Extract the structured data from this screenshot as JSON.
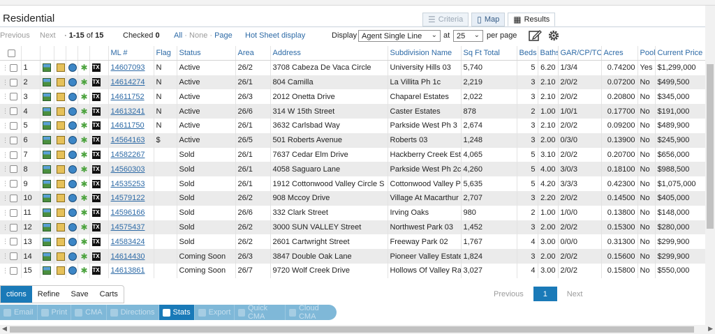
{
  "header": {
    "title": "Residential",
    "tabs": {
      "criteria": "Criteria",
      "map": "Map",
      "results": "Results"
    }
  },
  "toolbar": {
    "previous": "Previous",
    "next": "Next",
    "range": "1-15",
    "of_label": "of",
    "total": "15",
    "checked_label": "Checked",
    "checked_count": "0",
    "select_all": "All",
    "select_none": "None",
    "select_page": "Page",
    "hot_sheet": "Hot Sheet display",
    "display_label": "Display",
    "display_value": "Agent Single Line",
    "at_label": "at",
    "per_page_value": "25",
    "per_page_label": "per page"
  },
  "table": {
    "columns": [
      "ML #",
      "Flag",
      "Status",
      "Area",
      "Address",
      "Subdivision Name",
      "Sq Ft Total",
      "Beds",
      "Baths",
      "GAR/CP/TCP",
      "Acres",
      "Pool",
      "Current Price"
    ],
    "rows": [
      {
        "n": "1",
        "ml": "14607093",
        "flag": "N",
        "status": "Active",
        "area": "26/2",
        "address": "3708 Cabeza De Vaca Circle",
        "subdivision": "University Hills 03",
        "sqft": "5,740",
        "beds": "5",
        "baths": "6.20",
        "gar": "1/3/4",
        "acres": "0.74200",
        "pool": "Yes",
        "price": "$1,299,000"
      },
      {
        "n": "2",
        "ml": "14614274",
        "flag": "N",
        "status": "Active",
        "area": "26/1",
        "address": "804 Camilla",
        "subdivision": "La Villita Ph 1c",
        "sqft": "2,219",
        "beds": "3",
        "baths": "2.10",
        "gar": "2/0/2",
        "acres": "0.07200",
        "pool": "No",
        "price": "$499,500"
      },
      {
        "n": "3",
        "ml": "14611752",
        "flag": "N",
        "status": "Active",
        "area": "26/3",
        "address": "2012 Onetta Drive",
        "subdivision": "Chaparel Estates",
        "sqft": "2,022",
        "beds": "3",
        "baths": "2.10",
        "gar": "2/0/2",
        "acres": "0.20800",
        "pool": "No",
        "price": "$345,000"
      },
      {
        "n": "4",
        "ml": "14613241",
        "flag": "N",
        "status": "Active",
        "area": "26/6",
        "address": "314 W 15th Street",
        "subdivision": "Caster Estates",
        "sqft": "878",
        "beds": "2",
        "baths": "1.00",
        "gar": "1/0/1",
        "acres": "0.17700",
        "pool": "No",
        "price": "$191,000"
      },
      {
        "n": "5",
        "ml": "14611750",
        "flag": "N",
        "status": "Active",
        "area": "26/1",
        "address": "3632 Carlsbad Way",
        "subdivision": "Parkside West Ph 3",
        "sqft": "2,674",
        "beds": "3",
        "baths": "2.10",
        "gar": "2/0/2",
        "acres": "0.09200",
        "pool": "No",
        "price": "$489,900"
      },
      {
        "n": "6",
        "ml": "14564163",
        "flag": "$",
        "status": "Active",
        "area": "26/5",
        "address": "501 Roberts Avenue",
        "subdivision": "Roberts 03",
        "sqft": "1,248",
        "beds": "3",
        "baths": "2.00",
        "gar": "0/3/0",
        "acres": "0.13900",
        "pool": "No",
        "price": "$245,900"
      },
      {
        "n": "7",
        "ml": "14582267",
        "flag": "",
        "status": "Sold",
        "area": "26/1",
        "address": "7637 Cedar Elm Drive",
        "subdivision": "Hackberry Creek Esta",
        "sqft": "4,065",
        "beds": "5",
        "baths": "3.10",
        "gar": "2/0/2",
        "acres": "0.20700",
        "pool": "No",
        "price": "$656,000"
      },
      {
        "n": "8",
        "ml": "14560303",
        "flag": "",
        "status": "Sold",
        "area": "26/1",
        "address": "4058 Saguaro Lane",
        "subdivision": "Parkside West Ph 2c",
        "sqft": "4,260",
        "beds": "5",
        "baths": "4.00",
        "gar": "3/0/3",
        "acres": "0.18100",
        "pool": "No",
        "price": "$988,500"
      },
      {
        "n": "9",
        "ml": "14535253",
        "flag": "",
        "status": "Sold",
        "area": "26/1",
        "address": "1912 Cottonwood Valley Circle S",
        "subdivision": "Cottonwood Valley Ph",
        "sqft": "5,635",
        "beds": "5",
        "baths": "4.20",
        "gar": "3/3/3",
        "acres": "0.42300",
        "pool": "No",
        "price": "$1,075,000"
      },
      {
        "n": "10",
        "ml": "14579122",
        "flag": "",
        "status": "Sold",
        "area": "26/2",
        "address": "908 Mccoy Drive",
        "subdivision": "Village At Macarthur C",
        "sqft": "2,707",
        "beds": "3",
        "baths": "2.20",
        "gar": "2/0/2",
        "acres": "0.14500",
        "pool": "No",
        "price": "$405,000"
      },
      {
        "n": "11",
        "ml": "14596166",
        "flag": "",
        "status": "Sold",
        "area": "26/6",
        "address": "332 Clark Street",
        "subdivision": "Irving Oaks",
        "sqft": "980",
        "beds": "2",
        "baths": "1.00",
        "gar": "1/0/0",
        "acres": "0.13800",
        "pool": "No",
        "price": "$148,000"
      },
      {
        "n": "12",
        "ml": "14575437",
        "flag": "",
        "status": "Sold",
        "area": "26/2",
        "address": "3000 SUN VALLEY Street",
        "subdivision": "Northwest Park 03",
        "sqft": "1,452",
        "beds": "3",
        "baths": "2.00",
        "gar": "2/0/2",
        "acres": "0.15300",
        "pool": "No",
        "price": "$280,000"
      },
      {
        "n": "13",
        "ml": "14583424",
        "flag": "",
        "status": "Sold",
        "area": "26/2",
        "address": "2601 Cartwright Street",
        "subdivision": "Freeway Park 02",
        "sqft": "1,767",
        "beds": "4",
        "baths": "3.00",
        "gar": "0/0/0",
        "acres": "0.31300",
        "pool": "No",
        "price": "$299,900"
      },
      {
        "n": "14",
        "ml": "14614430",
        "flag": "",
        "status": "Coming Soon",
        "area": "26/3",
        "address": "3847 Double Oak Lane",
        "subdivision": "Pioneer Valley Estate",
        "sqft": "1,824",
        "beds": "3",
        "baths": "2.00",
        "gar": "2/0/2",
        "acres": "0.15600",
        "pool": "No",
        "price": "$299,900"
      },
      {
        "n": "15",
        "ml": "14613861",
        "flag": "",
        "status": "Coming Soon",
        "area": "26/7",
        "address": "9720 Wolf Creek Drive",
        "subdivision": "Hollows Of Valley Ran",
        "sqft": "3,027",
        "beds": "4",
        "baths": "3.00",
        "gar": "2/0/2",
        "acres": "0.15800",
        "pool": "No",
        "price": "$550,000"
      }
    ]
  },
  "bottom_tabs": [
    "ctions",
    "Refine",
    "Save",
    "Carts"
  ],
  "actions": [
    "Email",
    "Print",
    "CMA",
    "Directions",
    "Stats",
    "Export",
    "Quick CMA",
    "Cloud CMA"
  ],
  "pager": {
    "previous": "Previous",
    "current": "1",
    "next": "Next"
  },
  "row_icons": [
    "photo-icon",
    "document-icon",
    "history-icon",
    "leaf-icon",
    "tx-icon"
  ],
  "row_icon_tx_text": "TX",
  "icons": {
    "criteria_icon": "sliders-icon",
    "map_icon": "map-icon",
    "results_icon": "table-icon",
    "edit_icon": "edit-icon",
    "settings_icon": "gear-icon",
    "drag_handle": "drag-handle-icon"
  },
  "colors": {
    "accent": "#1a7ab8",
    "link": "#2d6aa6",
    "actions_bar": "#7fb8d8"
  }
}
